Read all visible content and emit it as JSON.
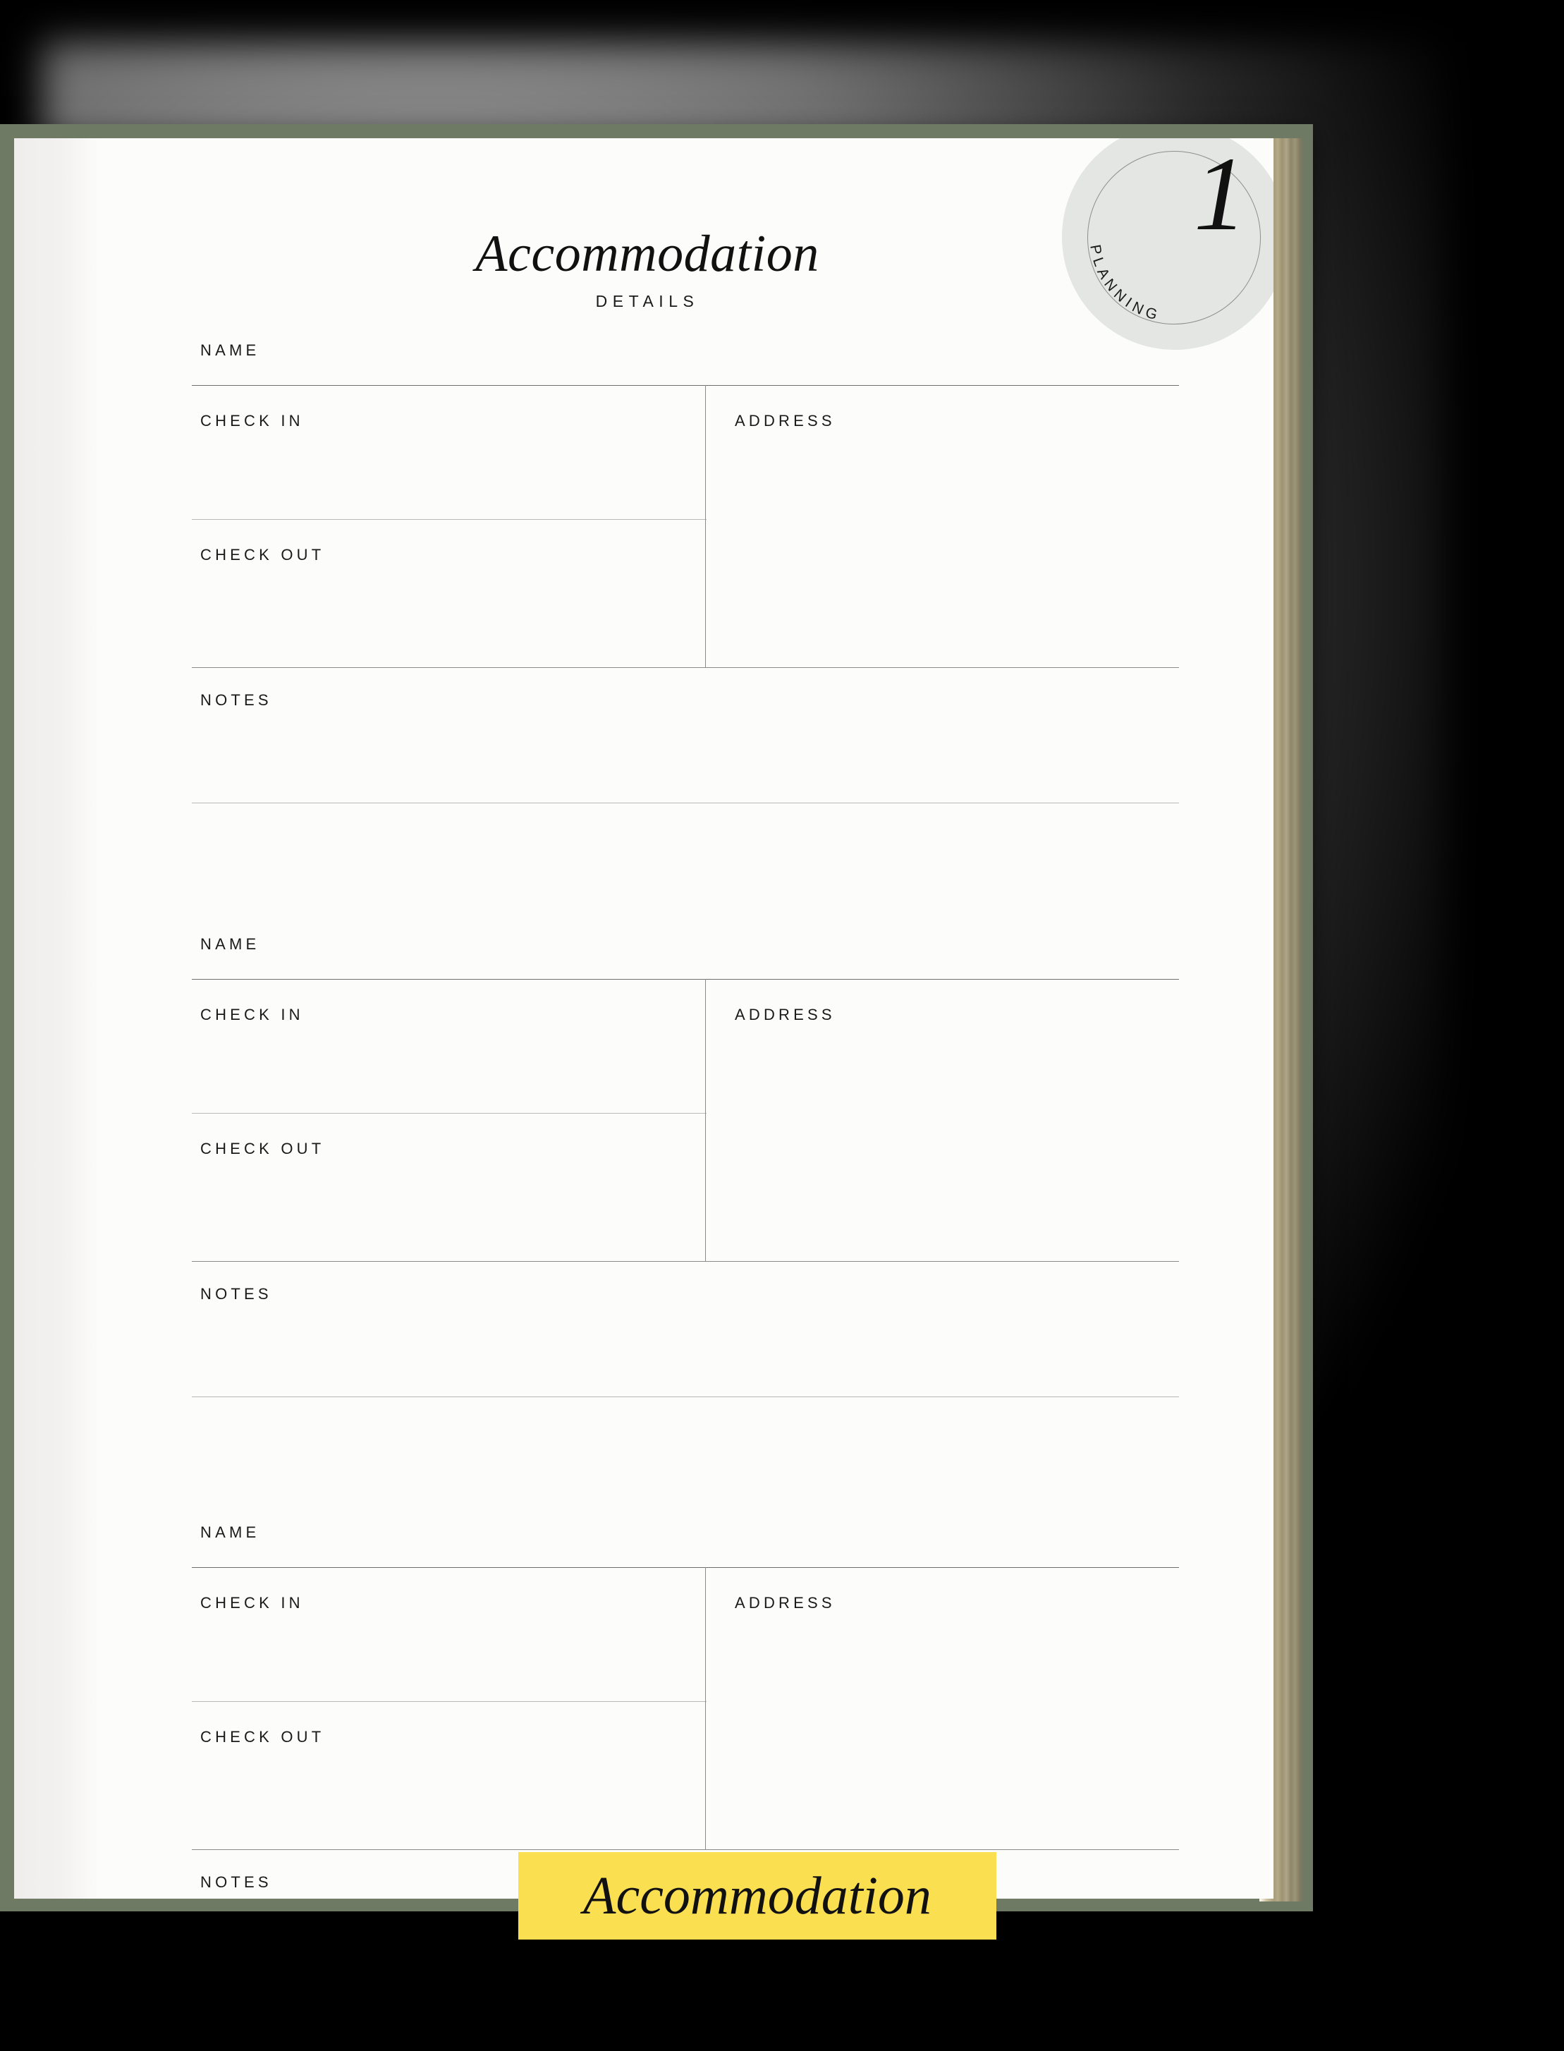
{
  "page": {
    "title": "Accommodation",
    "subtitle": "DETAILS"
  },
  "badge": {
    "number": "1",
    "label": "PLANNING"
  },
  "banner": {
    "text": "Accommodation"
  },
  "labels": {
    "name": "NAME",
    "check_in": "CHECK IN",
    "check_out": "CHECK OUT",
    "address": "ADDRESS",
    "notes": "NOTES"
  },
  "blocks": [
    {
      "name": "NAME",
      "check_in": "CHECK IN",
      "check_out": "CHECK OUT",
      "address": "ADDRESS",
      "notes": "NOTES"
    },
    {
      "name": "NAME",
      "check_in": "CHECK IN",
      "check_out": "CHECK OUT",
      "address": "ADDRESS",
      "notes": "NOTES"
    },
    {
      "name": "NAME",
      "check_in": "CHECK IN",
      "check_out": "CHECK OUT",
      "address": "ADDRESS",
      "notes": "NOTES"
    }
  ],
  "colors": {
    "cover_green": "#6E7A64",
    "banner_yellow": "#FADF51",
    "badge_gray": "#E4E6E3",
    "paper": "#FCFCFA",
    "rule": "#6e6e6e",
    "text": "#111111"
  }
}
